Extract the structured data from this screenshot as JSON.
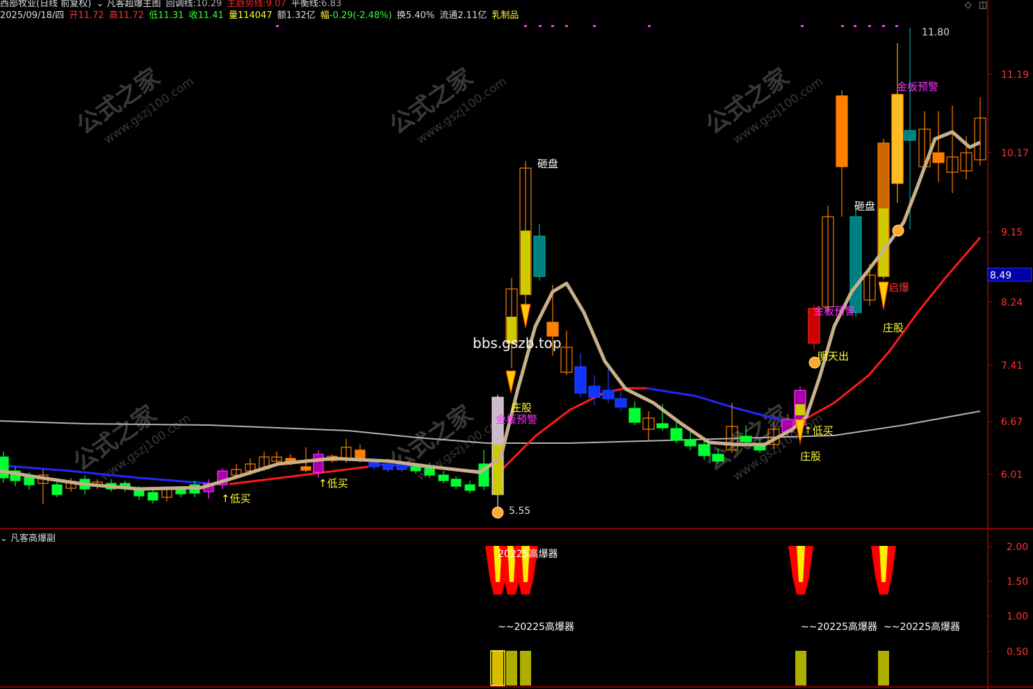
{
  "header": {
    "stock_name": "西部牧业(日线 前复权)",
    "indicator_name": "凡客超爆主图",
    "hui_diao_label": "回调线:",
    "hui_diao_value": "10.29",
    "zhu_qu_label": "主趋势线:",
    "zhu_qu_value": "9.07",
    "ping_heng_label": "平衡线:",
    "ping_heng_value": "6.83",
    "date": "2025/09/18/四",
    "open_label": "开",
    "open_value": "11.72",
    "high_label": "高",
    "high_value": "11.72",
    "low_label": "低",
    "low_value": "11.31",
    "close_label": "收",
    "close_value": "11.41",
    "vol_label": "量",
    "vol_value": "114047",
    "amount_label": "额",
    "amount_value": "1.32亿",
    "change_label": "幅",
    "change_value": "-0.29(-2.48%)",
    "turnover_label": "换",
    "turnover_value": "5.40%",
    "float_label": "流通",
    "float_value": "2.11亿",
    "sector": "乳制品"
  },
  "icons": {
    "dropdown": "chevron-down-icon",
    "diamond": "diamond-icon",
    "window": "window-icon"
  },
  "main_axis": {
    "labels": [
      "11.19",
      "10.17",
      "9.15",
      "8.24",
      "7.41",
      "6.67",
      "6.01"
    ],
    "current_price": "8.49"
  },
  "annotations": {
    "high_price": "11.80",
    "low_price": "5.55",
    "za_pan": "砸盘",
    "zhuang_gu": "庄股",
    "jin_ban": "金板预警",
    "di_mai": "↑低买",
    "ming_tian_chu": "明天出",
    "qi_bao": "启爆",
    "watermark_site": "公式之家",
    "watermark_url": "www.gszj100.com",
    "overlay": "bbs.gszb.top"
  },
  "sub_chart": {
    "title": "凡客高爆副",
    "axis_labels": [
      "2.00",
      "1.50",
      "1.00",
      "0.50"
    ],
    "top_label": "20225高爆器",
    "mid_label_1": "~~20225高爆器",
    "mid_label_2": "~~20225高爆器",
    "mid_label_3": "~~20225高爆器"
  },
  "colors": {
    "up": "#ff7f00",
    "down": "#00ff33",
    "ma_tan": "#c8b08a",
    "ma_red": "#ff1a1a",
    "ma_blue": "#2222ff",
    "ma_white": "#bbbbbb",
    "yellow_label": "#ffff33",
    "magenta": "#ff33ff",
    "axis_red": "#cc0000"
  }
}
